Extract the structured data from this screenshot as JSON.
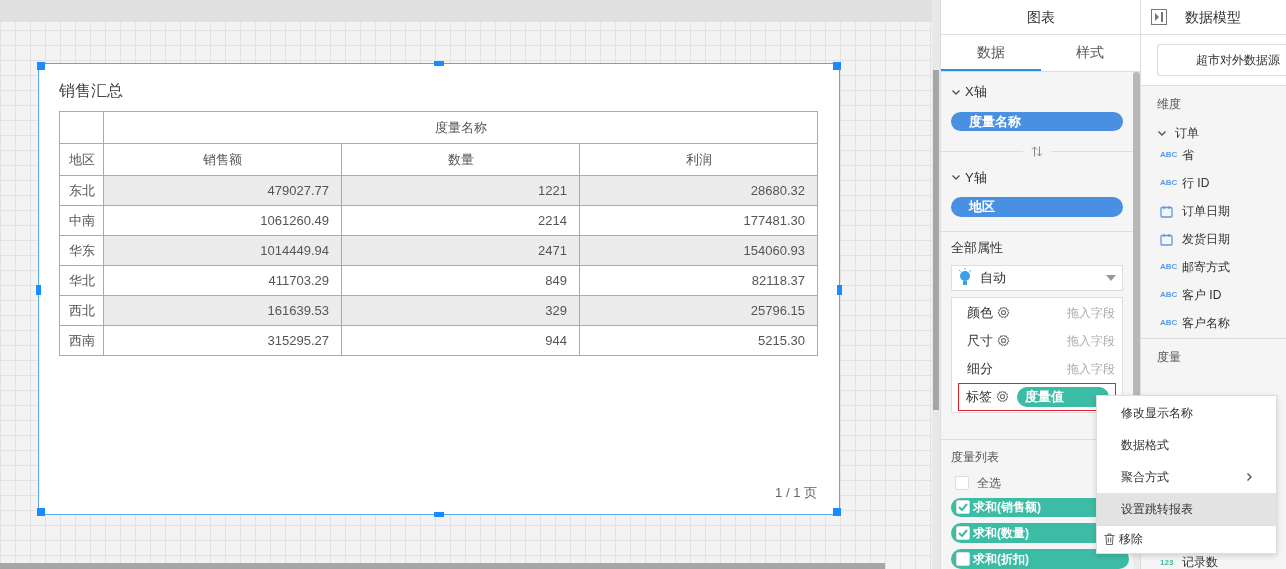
{
  "canvas": {
    "widget": {
      "title": "销售汇总",
      "table": {
        "group_header": "度量名称",
        "columns": [
          "地区",
          "销售额",
          "数量",
          "利润"
        ],
        "rows": [
          {
            "shaded": true,
            "cells": [
              "东北",
              "479027.77",
              "1221",
              "28680.32"
            ]
          },
          {
            "shaded": false,
            "cells": [
              "中南",
              "1061260.49",
              "2214",
              "177481.30"
            ]
          },
          {
            "shaded": true,
            "cells": [
              "华东",
              "1014449.94",
              "2471",
              "154060.93"
            ]
          },
          {
            "shaded": false,
            "cells": [
              "华北",
              "411703.29",
              "849",
              "82118.37"
            ]
          },
          {
            "shaded": true,
            "cells": [
              "西北",
              "161639.53",
              "329",
              "25796.15"
            ]
          },
          {
            "shaded": false,
            "cells": [
              "西南",
              "315295.27",
              "944",
              "5215.30"
            ]
          }
        ]
      },
      "pagination": "1 / 1 页",
      "selected": true
    }
  },
  "chart_panel": {
    "title": "图表",
    "tabs": [
      {
        "label": "数据",
        "selected": true
      },
      {
        "label": "样式",
        "selected": false
      }
    ],
    "x_axis": {
      "label": "X轴",
      "expanded": true,
      "field": "度量名称"
    },
    "y_axis": {
      "label": "Y轴",
      "expanded": true,
      "field": "地区"
    },
    "all_properties": {
      "title": "全部属性",
      "chart_type": "自动",
      "marks": [
        {
          "label": "颜色",
          "settings": true,
          "placeholder": "拖入字段",
          "highlighted": false
        },
        {
          "label": "尺寸",
          "settings": true,
          "placeholder": "拖入字段",
          "highlighted": false
        },
        {
          "label": "细分",
          "settings": false,
          "placeholder": "拖入字段",
          "highlighted": false
        },
        {
          "label": "标签",
          "settings": true,
          "field": "度量值",
          "highlighted": true
        }
      ]
    },
    "measure_list": {
      "title": "度量列表",
      "select_all": {
        "label": "全选",
        "checked": false
      },
      "items": [
        {
          "label": "求和(销售额)",
          "checked": true
        },
        {
          "label": "求和(数量)",
          "checked": true
        },
        {
          "label": "求和(折扣)",
          "checked": false
        }
      ]
    }
  },
  "data_model": {
    "title": "数据模型",
    "source": "超市对外数据源",
    "dimensions": {
      "title": "维度",
      "group": {
        "label": "订单",
        "expanded": true,
        "fields": [
          {
            "label": "省",
            "kind": "text",
            "badge": "ABC"
          },
          {
            "label": "行 ID",
            "kind": "text",
            "badge": "ABC"
          },
          {
            "label": "订单日期",
            "kind": "date"
          },
          {
            "label": "发货日期",
            "kind": "date"
          },
          {
            "label": "邮寄方式",
            "kind": "text",
            "badge": "ABC"
          },
          {
            "label": "客户 ID",
            "kind": "text",
            "badge": "ABC"
          },
          {
            "label": "客户名称",
            "kind": "text",
            "badge": "ABC"
          }
        ]
      }
    },
    "measures": {
      "title": "度量",
      "fields": [
        {
          "label": "记录数",
          "kind": "number",
          "badge": "123"
        }
      ]
    }
  },
  "context_menu": {
    "items": [
      {
        "label": "修改显示名称",
        "kind": "plain",
        "selected": false
      },
      {
        "label": "数据格式",
        "kind": "plain",
        "selected": false
      },
      {
        "label": "聚合方式",
        "kind": "submenu",
        "selected": false
      },
      {
        "label": "设置跳转报表",
        "kind": "plain",
        "selected": true
      },
      {
        "label": "移除",
        "kind": "remove",
        "selected": false
      }
    ]
  }
}
